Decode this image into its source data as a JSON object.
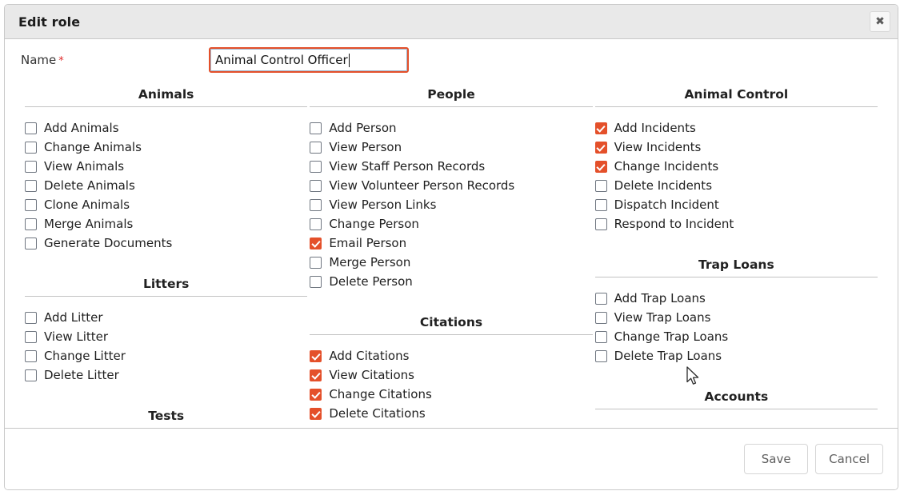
{
  "dialog": {
    "title": "Edit role",
    "close_icon": "close-icon",
    "close_glyph": "✖"
  },
  "form": {
    "name_label": "Name",
    "required_marker": "*",
    "name_value": "Animal Control Officer"
  },
  "colors": {
    "checked": "#e4502a",
    "unchecked_border": "#6f7680",
    "focus_ring": "#e4502a",
    "header_bg": "#e9e9e9",
    "required_star": "#e02b2b"
  },
  "columns": [
    {
      "sections": [
        {
          "title": "Animals",
          "items": [
            {
              "label": "Add Animals",
              "checked": false
            },
            {
              "label": "Change Animals",
              "checked": false
            },
            {
              "label": "View Animals",
              "checked": false
            },
            {
              "label": "Delete Animals",
              "checked": false
            },
            {
              "label": "Clone Animals",
              "checked": false
            },
            {
              "label": "Merge Animals",
              "checked": false
            },
            {
              "label": "Generate Documents",
              "checked": false
            }
          ]
        },
        {
          "title": "Litters",
          "items": [
            {
              "label": "Add Litter",
              "checked": false
            },
            {
              "label": "View Litter",
              "checked": false
            },
            {
              "label": "Change Litter",
              "checked": false
            },
            {
              "label": "Delete Litter",
              "checked": false
            }
          ]
        },
        {
          "title": "Tests",
          "items": []
        }
      ]
    },
    {
      "sections": [
        {
          "title": "People",
          "items": [
            {
              "label": "Add Person",
              "checked": false
            },
            {
              "label": "View Person",
              "checked": false
            },
            {
              "label": "View Staff Person Records",
              "checked": false
            },
            {
              "label": "View Volunteer Person Records",
              "checked": false
            },
            {
              "label": "View Person Links",
              "checked": false
            },
            {
              "label": "Change Person",
              "checked": false
            },
            {
              "label": "Email Person",
              "checked": true
            },
            {
              "label": "Merge Person",
              "checked": false
            },
            {
              "label": "Delete Person",
              "checked": false
            }
          ]
        },
        {
          "title": "Citations",
          "items": [
            {
              "label": "Add Citations",
              "checked": true
            },
            {
              "label": "View Citations",
              "checked": true
            },
            {
              "label": "Change Citations",
              "checked": true
            },
            {
              "label": "Delete Citations",
              "checked": true
            }
          ]
        }
      ]
    },
    {
      "sections": [
        {
          "title": "Animal Control",
          "items": [
            {
              "label": "Add Incidents",
              "checked": true
            },
            {
              "label": "View Incidents",
              "checked": true
            },
            {
              "label": "Change Incidents",
              "checked": true
            },
            {
              "label": "Delete Incidents",
              "checked": false
            },
            {
              "label": "Dispatch Incident",
              "checked": false
            },
            {
              "label": "Respond to Incident",
              "checked": false
            }
          ]
        },
        {
          "title": "Trap Loans",
          "items": [
            {
              "label": "Add Trap Loans",
              "checked": false
            },
            {
              "label": "View Trap Loans",
              "checked": false
            },
            {
              "label": "Change Trap Loans",
              "checked": false
            },
            {
              "label": "Delete Trap Loans",
              "checked": false
            }
          ]
        },
        {
          "title": "Accounts",
          "items": []
        }
      ]
    }
  ],
  "footer": {
    "save_label": "Save",
    "cancel_label": "Cancel"
  }
}
